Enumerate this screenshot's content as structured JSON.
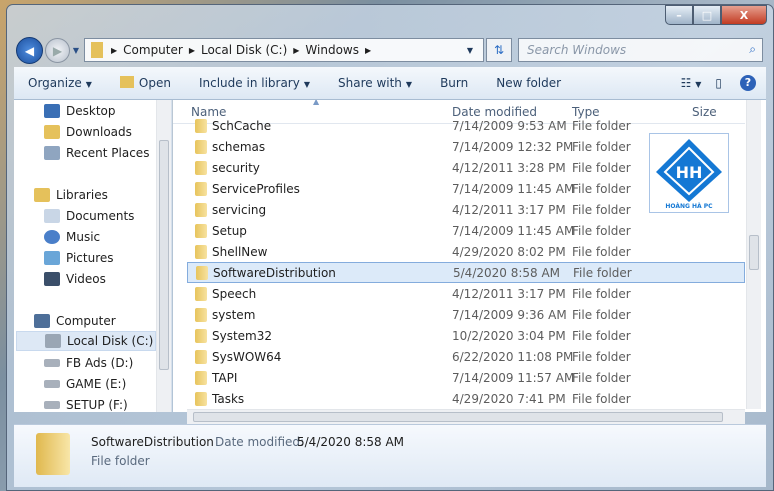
{
  "window": {
    "minimize": "–",
    "maximize": "□",
    "close": "X"
  },
  "address": {
    "crumbs": [
      "Computer",
      "Local Disk (C:)",
      "Windows"
    ],
    "search_placeholder": "Search Windows"
  },
  "toolbar": {
    "organize": "Organize",
    "open": "Open",
    "include": "Include in library",
    "share": "Share with",
    "burn": "Burn",
    "new_folder": "New folder"
  },
  "nav": {
    "favorites": [
      "Desktop",
      "Downloads",
      "Recent Places"
    ],
    "libraries": "Libraries",
    "library_items": [
      "Documents",
      "Music",
      "Pictures",
      "Videos"
    ],
    "computer": "Computer",
    "drives": [
      "Local Disk (C:)",
      "FB Ads (D:)",
      "GAME (E:)",
      "SETUP (F:)"
    ]
  },
  "columns": {
    "name": "Name",
    "date": "Date modified",
    "type": "Type",
    "size": "Size"
  },
  "files": [
    {
      "name": "SchCache",
      "date": "7/14/2009 9:53 AM",
      "type": "File folder"
    },
    {
      "name": "schemas",
      "date": "7/14/2009 12:32 PM",
      "type": "File folder"
    },
    {
      "name": "security",
      "date": "4/12/2011 3:28 PM",
      "type": "File folder"
    },
    {
      "name": "ServiceProfiles",
      "date": "7/14/2009 11:45 AM",
      "type": "File folder"
    },
    {
      "name": "servicing",
      "date": "4/12/2011 3:17 PM",
      "type": "File folder"
    },
    {
      "name": "Setup",
      "date": "7/14/2009 11:45 AM",
      "type": "File folder"
    },
    {
      "name": "ShellNew",
      "date": "4/29/2020 8:02 PM",
      "type": "File folder"
    },
    {
      "name": "SoftwareDistribution",
      "date": "5/4/2020 8:58 AM",
      "type": "File folder"
    },
    {
      "name": "Speech",
      "date": "4/12/2011 3:17 PM",
      "type": "File folder"
    },
    {
      "name": "system",
      "date": "7/14/2009 9:36 AM",
      "type": "File folder"
    },
    {
      "name": "System32",
      "date": "10/2/2020 3:04 PM",
      "type": "File folder"
    },
    {
      "name": "SysWOW64",
      "date": "6/22/2020 11:08 PM",
      "type": "File folder"
    },
    {
      "name": "TAPI",
      "date": "7/14/2009 11:57 AM",
      "type": "File folder"
    },
    {
      "name": "Tasks",
      "date": "4/29/2020 7:41 PM",
      "type": "File folder"
    }
  ],
  "details": {
    "name": "SoftwareDistribution",
    "date_label": "Date modified:",
    "date": "5/4/2020 8:58 AM",
    "type": "File folder"
  },
  "watermark": {
    "text": "HOÀNG HÀ PC"
  }
}
